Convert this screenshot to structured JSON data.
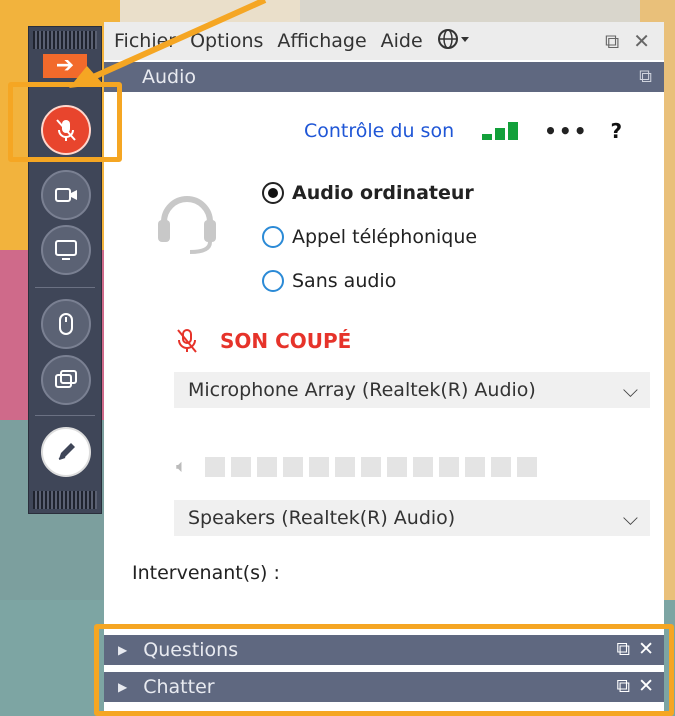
{
  "menu": {
    "items": [
      "Fichier",
      "Options",
      "Affichage",
      "Aide"
    ],
    "globe_icon": "globe-icon",
    "restore_icon": "restore-icon",
    "close_icon": "close-icon"
  },
  "audio_section": {
    "title": "Audio",
    "sound_control_link": "Contrôle du son",
    "more_label": "•••",
    "help_label": "?",
    "options": [
      "Audio ordinateur",
      "Appel téléphonique",
      "Sans audio"
    ],
    "selected_option": "Audio ordinateur",
    "mute_status": "SON COUPÉ",
    "microphone_select": "Microphone Array (Realtek(R) Audio)",
    "speaker_select": "Speakers (Realtek(R) Audio)",
    "speakers_label": "Intervenant(s) :"
  },
  "panels": {
    "questions_label": "Questions",
    "chat_label": "Chatter"
  },
  "colors": {
    "accent_orange": "#f5a623",
    "mute_red": "#e6332a",
    "header_slate": "#5f6880",
    "signal_green": "#12a03a"
  }
}
